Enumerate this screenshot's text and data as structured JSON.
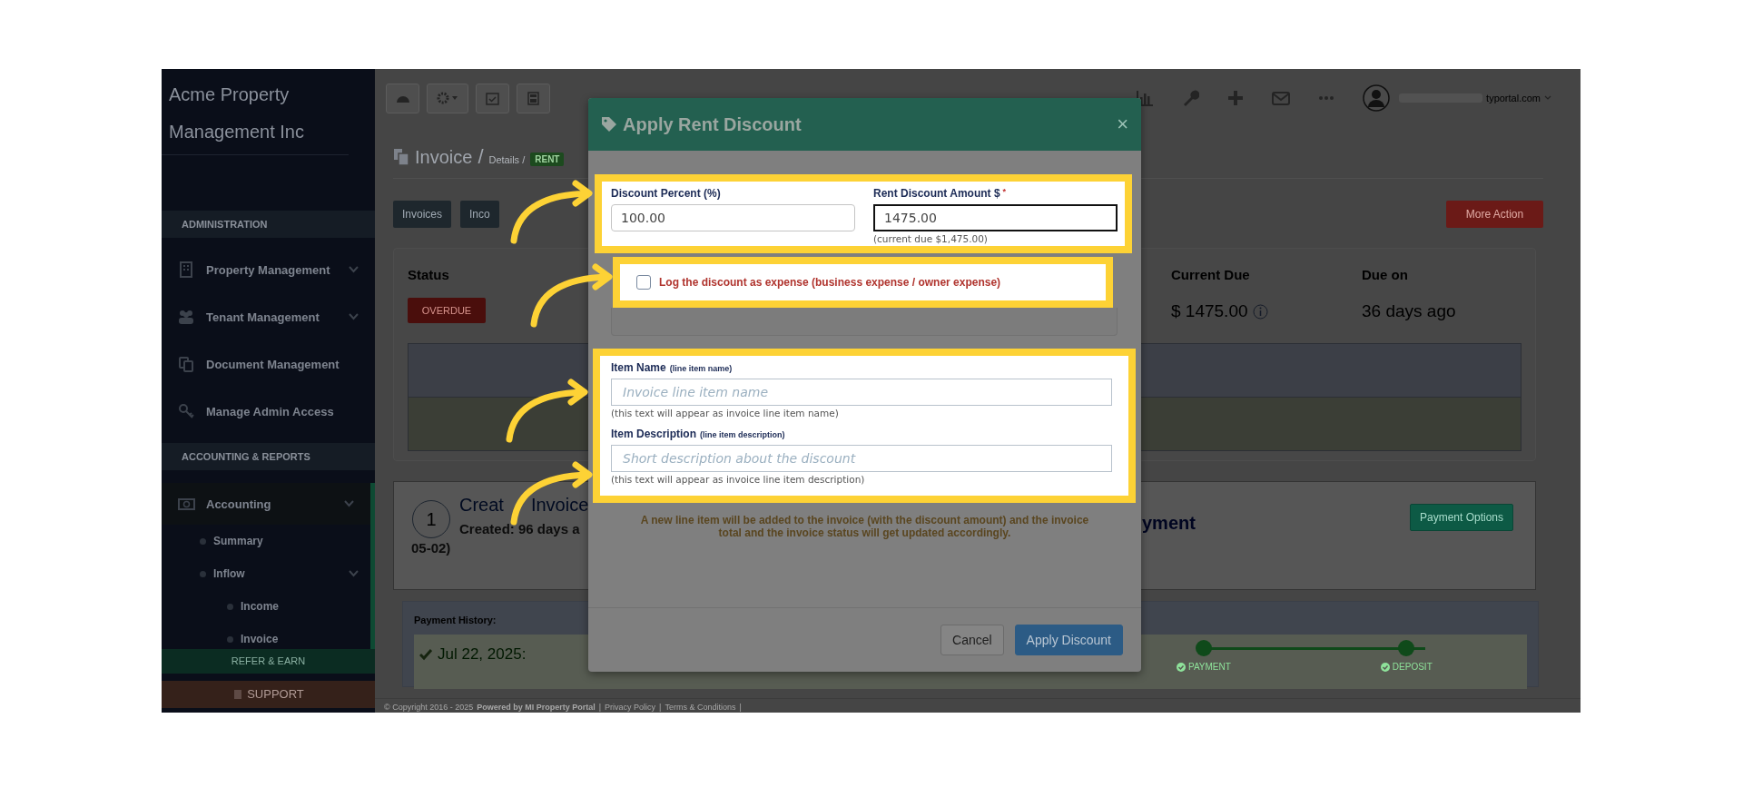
{
  "sidebar": {
    "company": "Acme Property Management Inc",
    "sections": [
      {
        "heading": "ADMINISTRATION",
        "items": [
          {
            "label": "Property Management",
            "expandable": true,
            "selected": false
          },
          {
            "label": "Tenant Management",
            "expandable": true,
            "selected": false
          },
          {
            "label": "Document Management",
            "expandable": false,
            "selected": false
          },
          {
            "label": "Manage Admin Access",
            "expandable": false,
            "selected": false
          }
        ]
      },
      {
        "heading": "ACCOUNTING & REPORTS",
        "items": [
          {
            "label": "Accounting",
            "expandable": true,
            "selected": true,
            "children": [
              {
                "label": "Summary",
                "expandable": false
              },
              {
                "label": "Inflow",
                "expandable": true,
                "children": [
                  {
                    "label": "Income"
                  },
                  {
                    "label": "Invoice"
                  }
                ]
              }
            ]
          }
        ]
      }
    ],
    "refer": "REFER & EARN",
    "support": "SUPPORT"
  },
  "topbar": {
    "user_email": "typortal.com"
  },
  "page": {
    "title": "Invoice",
    "separator": "/",
    "crumb": "Details /",
    "badge": "RENT"
  },
  "actions": [
    "Invoices",
    "Inco"
  ],
  "more_action": "More Action",
  "status": {
    "label": "Status",
    "badge": "OVERDUE",
    "current_due_label": "Current Due",
    "current_due": "$ 1475.00",
    "due_on_label": "Due on",
    "due_on": "36 days ago"
  },
  "step": {
    "number": "1",
    "title": "Creat",
    "title_rest": "Invoice",
    "created": "Created: 96 days a",
    "date_tail": "05-02)",
    "next_title": "yment",
    "button": "Payment Options"
  },
  "payment_history": {
    "title": "Payment History:",
    "date": "Jul 22, 2025:",
    "milestones": [
      {
        "label": "PAYMENT",
        "done": true
      },
      {
        "label": "DEPOSIT",
        "done": true
      }
    ]
  },
  "footer": [
    {
      "text": "© Copyright 2016 - 2025",
      "kind": "text"
    },
    {
      "text": "Powered by MI Property Portal",
      "kind": "strong"
    },
    {
      "text": "|",
      "kind": "separator"
    },
    {
      "text": "Privacy Policy",
      "kind": "link"
    },
    {
      "text": "|",
      "kind": "separator"
    },
    {
      "text": "Terms & Conditions",
      "kind": "link"
    },
    {
      "text": "|",
      "kind": "separator"
    }
  ],
  "modal": {
    "title": "Apply Rent Discount",
    "close": "×",
    "fields": [
      {
        "label": "Discount Percent (%)",
        "value": "100.00",
        "focused": false
      },
      {
        "label": "Rent Discount Amount $",
        "required_mark": "*",
        "value": "1475.00",
        "focused": true,
        "help": "(current due $1,475.00)"
      }
    ],
    "expense": {
      "label": "Log the discount as expense (business expense / owner expense)",
      "checked": false
    },
    "item_fields": [
      {
        "label": "Item Name",
        "hint": "(line item name)",
        "placeholder": "Invoice line item name",
        "help": "(this text will appear as invoice line item name)"
      },
      {
        "label": "Item Description",
        "hint": "(line item description)",
        "placeholder": "Short description about the discount",
        "help": "(this text will appear as invoice line item description)"
      }
    ],
    "note": "A new line item will be added to the invoice (with the discount amount) and the invoice total and the invoice status will get updated accordingly.",
    "buttons": [
      {
        "label": "Cancel",
        "kind": "default"
      },
      {
        "label": "Apply Discount",
        "kind": "primary"
      }
    ]
  }
}
